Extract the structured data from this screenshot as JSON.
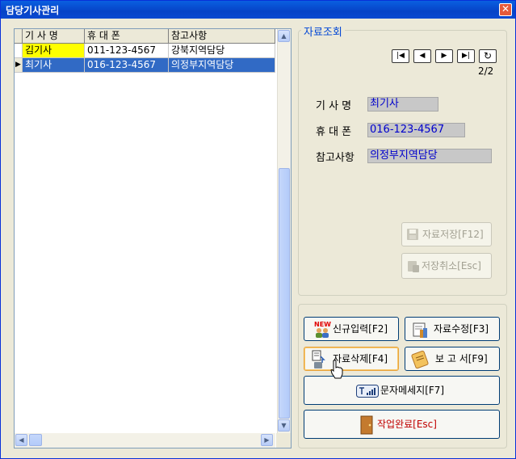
{
  "window": {
    "title": "담당기사관리",
    "close_glyph": "✕"
  },
  "grid": {
    "columns": [
      "기 사 명",
      "휴 대 폰",
      "참고사항"
    ],
    "rows": [
      {
        "name": "김기사",
        "phone": "011-123-4567",
        "note": "강북지역담당"
      },
      {
        "name": "최기사",
        "phone": "016-123-4567",
        "note": "의정부지역담당",
        "indicator": "▶"
      }
    ]
  },
  "lookup": {
    "legend": "자료조회",
    "counter": "2/2",
    "nav": {
      "first": "|◀",
      "prev": "◀",
      "next": "▶",
      "last": "▶|",
      "refresh": "↻"
    },
    "fields": {
      "name_label": "기 사 명",
      "name_value": "최기사",
      "phone_label": "휴 대 폰",
      "phone_value": "016-123-4567",
      "note_label": "참고사항",
      "note_value": "의정부지역담당"
    },
    "save_label": "자료저장[F12]",
    "cancel_label": "저장취소[Esc]"
  },
  "actions": {
    "new_label": "신규입력[F2]",
    "edit_label": "자료수정[F3]",
    "delete_label": "자료삭제[F4]",
    "report_label": "보 고 서[F9]",
    "sms_label": "문자메세지[F7]",
    "done_label": "작업완료[Esc]",
    "new_badge": "NEW"
  },
  "colors": {
    "accent": "#316AC5",
    "highlight": "#FFFF00",
    "value_text": "#0000CC",
    "done_text": "#C00000"
  }
}
